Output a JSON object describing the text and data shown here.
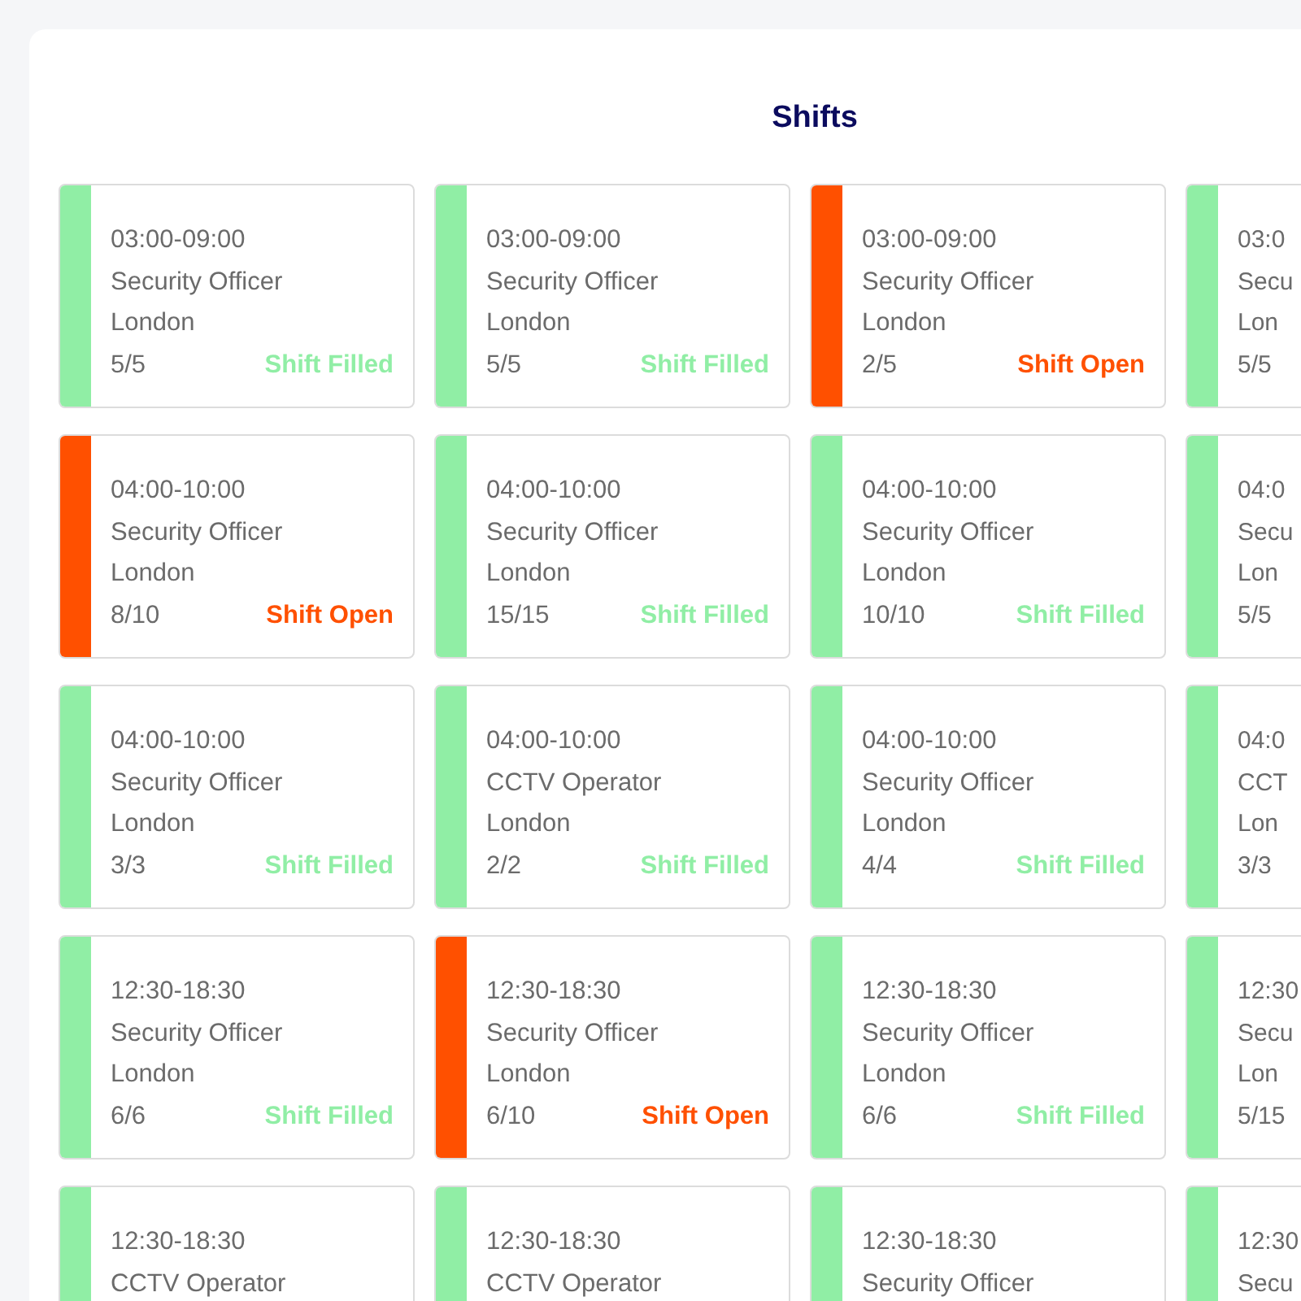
{
  "title": "Shifts",
  "shifts": [
    {
      "time": "03:00-09:00",
      "role": "Security Officer",
      "location": "London",
      "count": "5/5",
      "status": "Shift Filled",
      "open": false
    },
    {
      "time": "03:00-09:00",
      "role": "Security Officer",
      "location": "London",
      "count": "5/5",
      "status": "Shift Filled",
      "open": false
    },
    {
      "time": "03:00-09:00",
      "role": "Security Officer",
      "location": "London",
      "count": "2/5",
      "status": "Shift Open",
      "open": true
    },
    {
      "time": "03:0",
      "role": "Secu",
      "location": "Lon",
      "count": "5/5",
      "open": false
    },
    {
      "time": "04:00-10:00",
      "role": "Security Officer",
      "location": "London",
      "count": "8/10",
      "status": "Shift Open",
      "open": true
    },
    {
      "time": "04:00-10:00",
      "role": "Security Officer",
      "location": "London",
      "count": "15/15",
      "status": "Shift Filled",
      "open": false
    },
    {
      "time": "04:00-10:00",
      "role": "Security Officer",
      "location": "London",
      "count": "10/10",
      "status": "Shift Filled",
      "open": false
    },
    {
      "time": "04:0",
      "role": "Secu",
      "location": "Lon",
      "count": "5/5",
      "open": false
    },
    {
      "time": "04:00-10:00",
      "role": "Security Officer",
      "location": "London",
      "count": "3/3",
      "status": "Shift Filled",
      "open": false
    },
    {
      "time": "04:00-10:00",
      "role": "CCTV Operator",
      "location": "London",
      "count": "2/2",
      "status": "Shift Filled",
      "open": false
    },
    {
      "time": "04:00-10:00",
      "role": "Security Officer",
      "location": "London",
      "count": "4/4",
      "status": "Shift Filled",
      "open": false
    },
    {
      "time": "04:0",
      "role": "CCT",
      "location": "Lon",
      "count": "3/3",
      "open": false
    },
    {
      "time": "12:30-18:30",
      "role": "Security Officer",
      "location": "London",
      "count": "6/6",
      "status": "Shift Filled",
      "open": false
    },
    {
      "time": "12:30-18:30",
      "role": "Security Officer",
      "location": "London",
      "count": "6/10",
      "status": "Shift Open",
      "open": true
    },
    {
      "time": "12:30-18:30",
      "role": "Security Officer",
      "location": "London",
      "count": "6/6",
      "status": "Shift Filled",
      "open": false
    },
    {
      "time": "12:30",
      "role": "Secu",
      "location": "Lon",
      "count": "5/15",
      "open": false
    },
    {
      "time": "12:30-18:30",
      "role": "CCTV Operator",
      "open": false
    },
    {
      "time": "12:30-18:30",
      "role": "CCTV Operator",
      "open": false
    },
    {
      "time": "12:30-18:30",
      "role": "Security Officer",
      "open": false
    },
    {
      "time": "12:30",
      "role": "Secu",
      "open": false
    }
  ]
}
